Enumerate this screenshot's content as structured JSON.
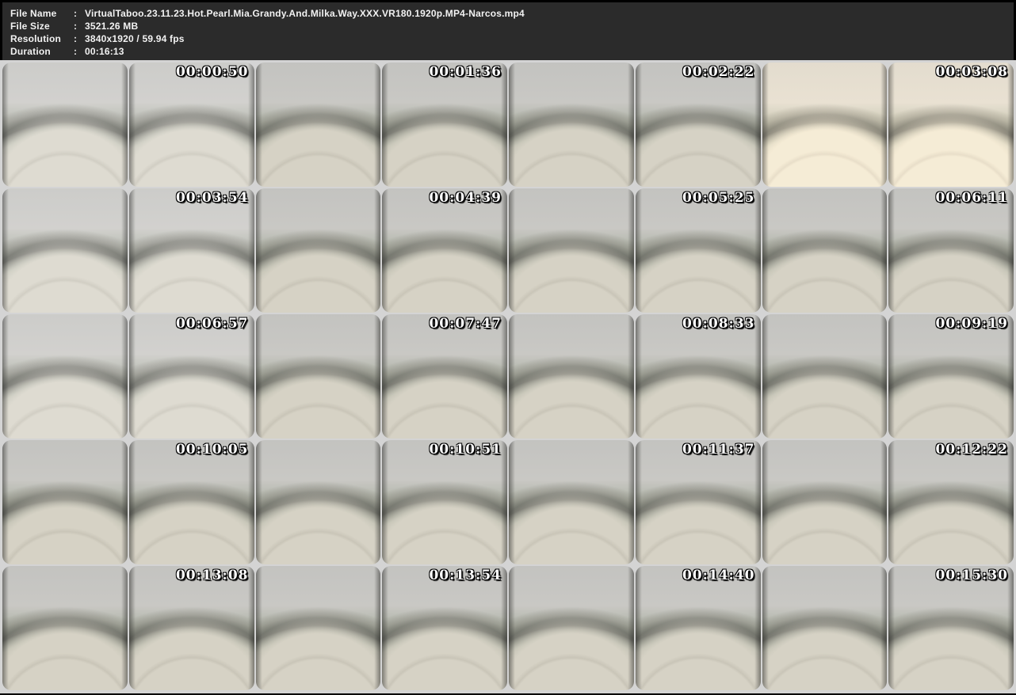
{
  "header": {
    "separator": ":",
    "bg_color": "#2b2b2b",
    "text_color": "#f2f2f2",
    "fields": [
      {
        "label": "File Name",
        "value": "VirtualTaboo.23.11.23.Hot.Pearl.Mia.Grandy.And.Milka.Way.XXX.VR180.1920p.MP4-Narcos.mp4"
      },
      {
        "label": "File Size",
        "value": "3521.26 MB"
      },
      {
        "label": "Resolution",
        "value": "3840x1920 / 59.94 fps"
      },
      {
        "label": "Duration",
        "value": "00:16:13"
      }
    ]
  },
  "grid": {
    "columns": 4,
    "rows": 5,
    "frame_color": "#d4d4d4",
    "timestamp_color": "#ffffff",
    "timestamp_outline_color": "#000000",
    "thumbnail_style": "vr180-side-by-side-stereo-pair",
    "thumbnails": [
      {
        "time": "00:00:50",
        "tone": "light"
      },
      {
        "time": "00:01:36",
        "tone": "room"
      },
      {
        "time": "00:02:22",
        "tone": "room"
      },
      {
        "time": "00:03:08",
        "tone": "warm"
      },
      {
        "time": "00:03:54",
        "tone": "light"
      },
      {
        "time": "00:04:39",
        "tone": "room"
      },
      {
        "time": "00:05:25",
        "tone": "room"
      },
      {
        "time": "00:06:11",
        "tone": "room"
      },
      {
        "time": "00:06:57",
        "tone": "light"
      },
      {
        "time": "00:07:47",
        "tone": "room"
      },
      {
        "time": "00:08:33",
        "tone": "room"
      },
      {
        "time": "00:09:19",
        "tone": "room"
      },
      {
        "time": "00:10:05",
        "tone": "room"
      },
      {
        "time": "00:10:51",
        "tone": "room"
      },
      {
        "time": "00:11:37",
        "tone": "room"
      },
      {
        "time": "00:12:22",
        "tone": "room"
      },
      {
        "time": "00:13:08",
        "tone": "room"
      },
      {
        "time": "00:13:54",
        "tone": "room"
      },
      {
        "time": "00:14:40",
        "tone": "room"
      },
      {
        "time": "00:15:30",
        "tone": "room"
      }
    ]
  }
}
